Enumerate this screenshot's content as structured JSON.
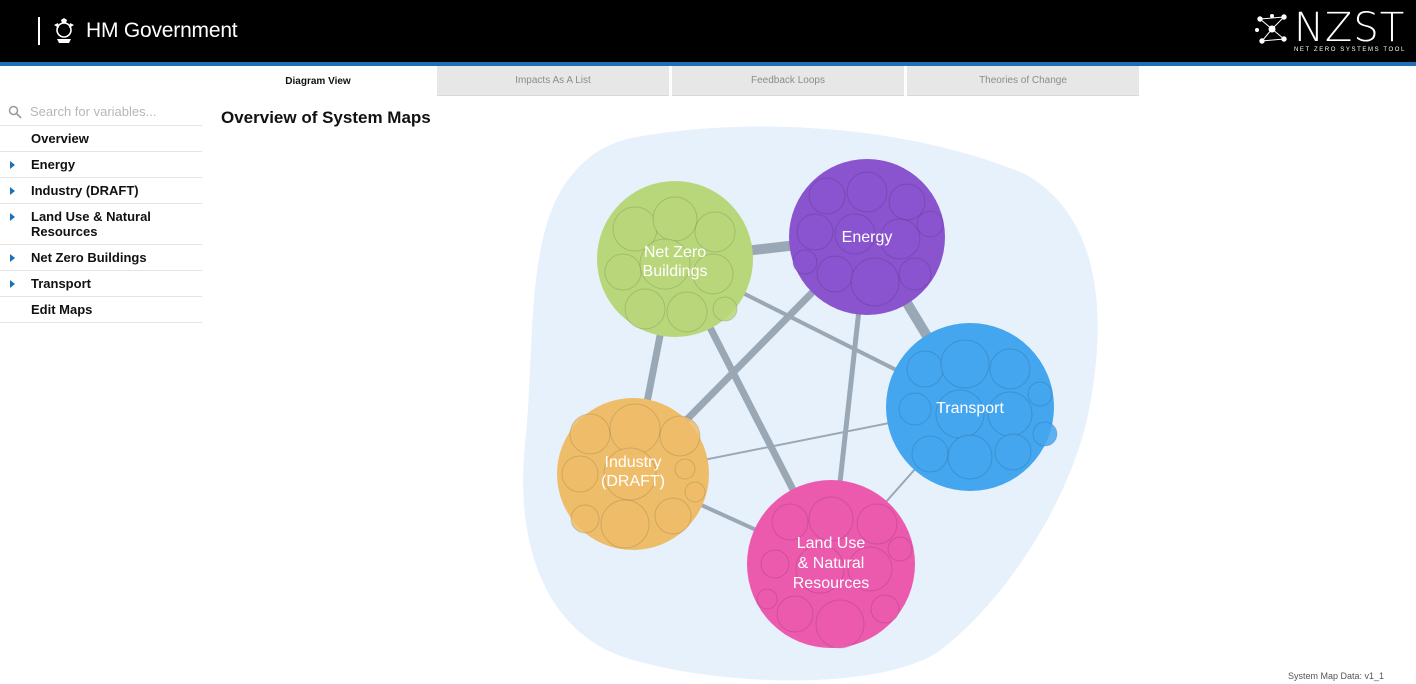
{
  "header": {
    "org_name": "HM Government",
    "app_logo_title": "NZST",
    "app_logo_subtitle": "NET ZERO SYSTEMS TOOL"
  },
  "tabs": [
    {
      "label": "Diagram View",
      "active": true
    },
    {
      "label": "Impacts As A List",
      "active": false
    },
    {
      "label": "Feedback Loops",
      "active": false
    },
    {
      "label": "Theories of Change",
      "active": false
    }
  ],
  "sidebar": {
    "search_placeholder": "Search for variables...",
    "items": [
      {
        "label": "Overview",
        "expandable": false
      },
      {
        "label": "Energy",
        "expandable": true
      },
      {
        "label": "Industry (DRAFT)",
        "expandable": true
      },
      {
        "label": "Land Use & Natural Resources",
        "expandable": true
      },
      {
        "label": "Net Zero Buildings",
        "expandable": true
      },
      {
        "label": "Transport",
        "expandable": true
      },
      {
        "label": "Edit Maps",
        "expandable": false
      }
    ]
  },
  "main": {
    "title": "Overview of System Maps",
    "nodes": {
      "buildings": {
        "label_line1": "Net Zero",
        "label_line2": "Buildings",
        "color": "#b8d77a"
      },
      "energy": {
        "label_line1": "Energy",
        "color": "#8a54cf"
      },
      "transport": {
        "label_line1": "Transport",
        "color": "#44a6ee"
      },
      "industry": {
        "label_line1": "Industry",
        "label_line2": "(DRAFT)",
        "color": "#eebd6a"
      },
      "landuse": {
        "label_line1": "Land Use",
        "label_line2": "& Natural",
        "label_line3": "Resources",
        "color": "#ec5aae"
      }
    },
    "blob_color": "#e6f1fb",
    "link_color": "#9aa8b5"
  },
  "footer": {
    "version_text": "System Map Data: v1_1"
  }
}
